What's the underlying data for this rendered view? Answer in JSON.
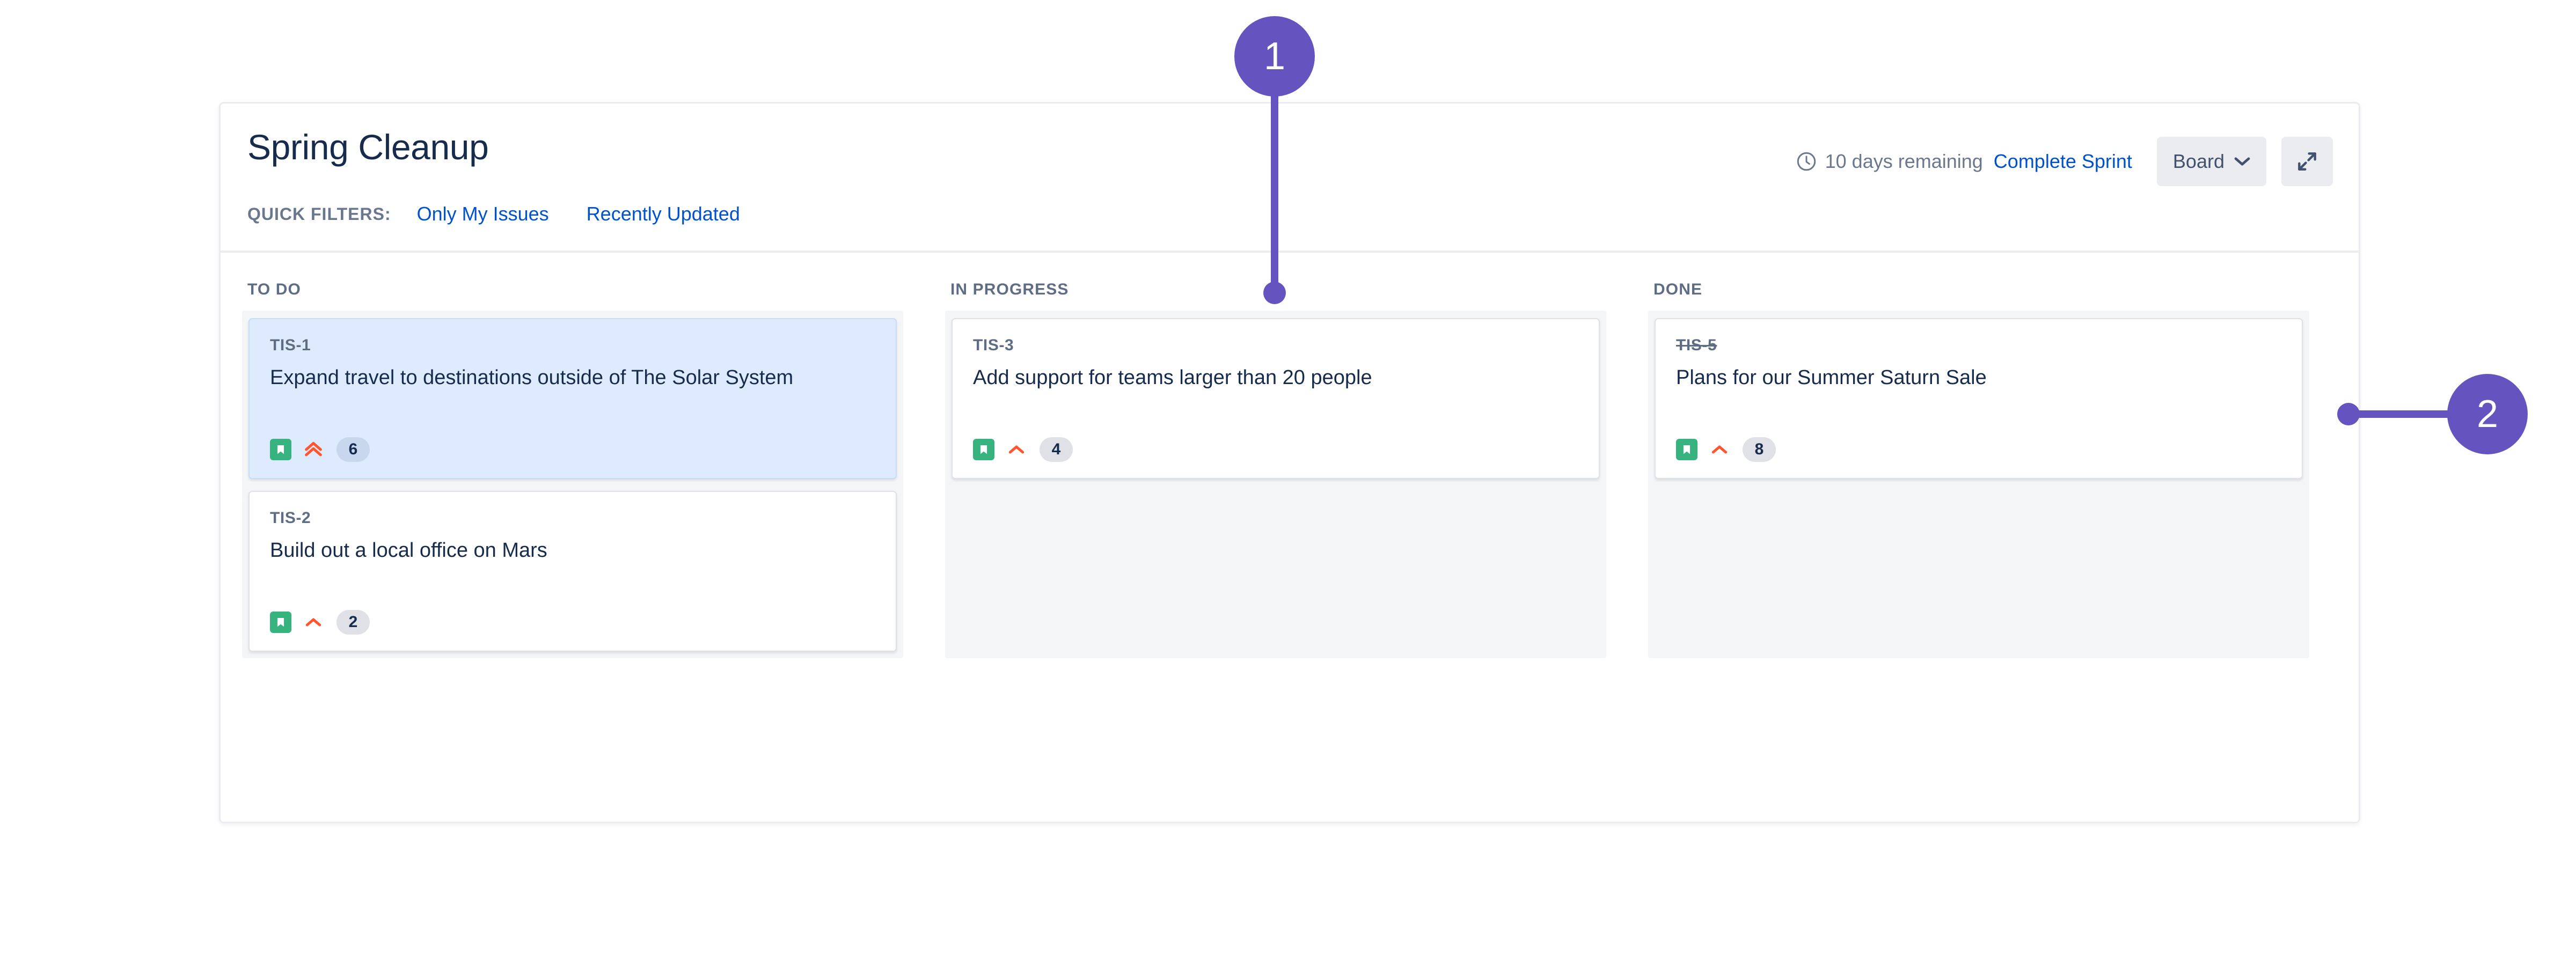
{
  "board": {
    "title": "Spring Cleanup",
    "quick_filters_label": "QUICK FILTERS:",
    "quick_filters": [
      {
        "label": "Only My Issues"
      },
      {
        "label": "Recently Updated"
      }
    ],
    "sprint_status": "10 days remaining",
    "complete_sprint_label": "Complete Sprint",
    "view_button_label": "Board",
    "icons": {
      "clock": "clock-icon",
      "chevron_down": "chevron-down-icon",
      "expand": "expand-icon",
      "story_type": "story-type-icon",
      "priority_highest": "priority-highest-icon",
      "priority_high": "priority-high-icon"
    },
    "colors": {
      "accent_link": "#0052CC",
      "annotation_purple": "#6554C0",
      "story_green": "#36B37E",
      "priority_orange": "#FF5630",
      "selected_card": "#DEEBFF",
      "column_bg": "#F4F5F7"
    },
    "columns": [
      {
        "name": "TO DO",
        "cards": [
          {
            "key": "TIS-1",
            "title": "Expand travel to destinations outside of The Solar System",
            "type": "Story",
            "priority": "Highest",
            "points": "6",
            "selected": true,
            "done": false
          },
          {
            "key": "TIS-2",
            "title": "Build out a local office on Mars",
            "type": "Story",
            "priority": "High",
            "points": "2",
            "selected": false,
            "done": false
          }
        ]
      },
      {
        "name": "IN PROGRESS",
        "cards": [
          {
            "key": "TIS-3",
            "title": "Add support for teams larger than 20 people",
            "type": "Story",
            "priority": "High",
            "points": "4",
            "selected": false,
            "done": false
          }
        ]
      },
      {
        "name": "DONE",
        "cards": [
          {
            "key": "TIS-5",
            "title": "Plans for our Summer Saturn Sale",
            "type": "Story",
            "priority": "High",
            "points": "8",
            "selected": false,
            "done": true
          }
        ]
      }
    ]
  },
  "annotations": [
    {
      "number": "1"
    },
    {
      "number": "2"
    }
  ]
}
